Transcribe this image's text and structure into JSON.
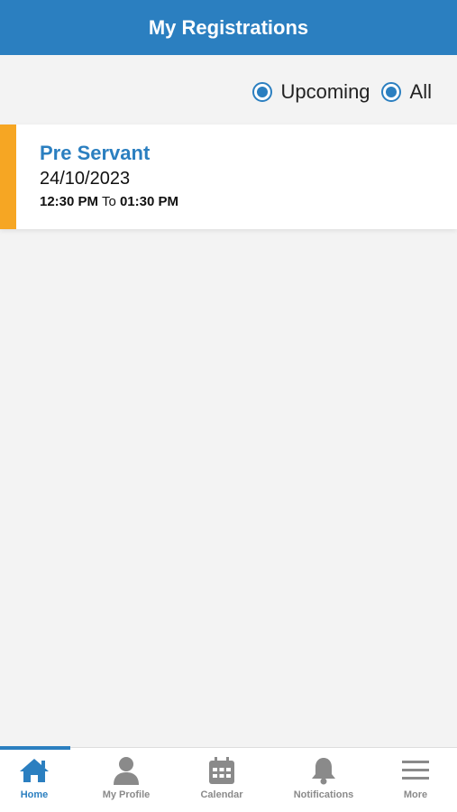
{
  "header": {
    "title": "My Registrations"
  },
  "filter": {
    "options": [
      {
        "label": "Upcoming",
        "selected": true
      },
      {
        "label": "All",
        "selected": true
      }
    ]
  },
  "registrations": [
    {
      "title": "Pre Servant",
      "date": "24/10/2023",
      "start_time": "12:30 PM",
      "separator": "To",
      "end_time": "01:30 PM"
    }
  ],
  "bottom_nav": {
    "items": [
      {
        "label": "Home",
        "icon": "home-icon",
        "active": true
      },
      {
        "label": "My Profile",
        "icon": "person-icon",
        "active": false
      },
      {
        "label": "Calendar",
        "icon": "calendar-icon",
        "active": false
      },
      {
        "label": "Notifications",
        "icon": "bell-icon",
        "active": false
      },
      {
        "label": "More",
        "icon": "menu-icon",
        "active": false
      }
    ]
  },
  "colors": {
    "primary": "#2b7fc0",
    "accent": "#f6a623",
    "background": "#f3f3f3",
    "inactive": "#8a8a8a"
  }
}
